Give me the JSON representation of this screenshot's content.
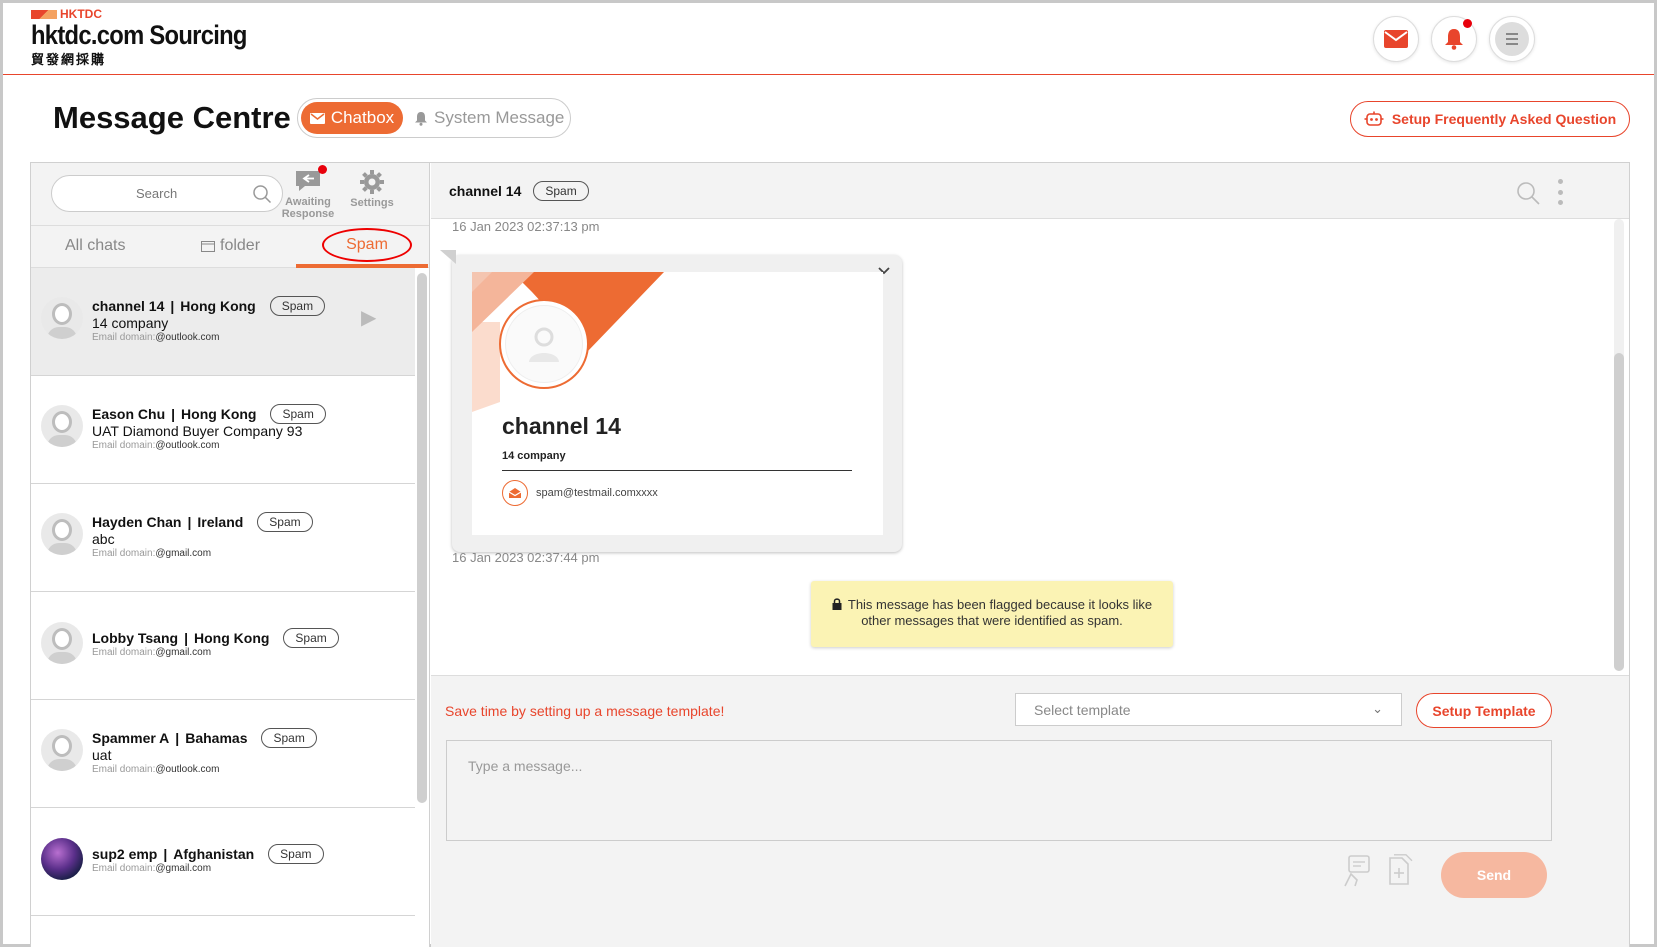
{
  "brand": {
    "org": "HKTDC",
    "name": "hktdc.com Sourcing",
    "sub": "貿發網採購",
    "accent": "#ed6b33"
  },
  "header": {
    "title": "Message Centre",
    "toggle": {
      "active": "Chatbox",
      "inactive": "System Message"
    },
    "faq_button": "Setup Frequently Asked Question"
  },
  "sidebar": {
    "search_placeholder": "Search",
    "awaiting_label": "Awaiting Response",
    "settings_label": "Settings",
    "tabs": [
      "All chats",
      "folder",
      "Spam"
    ],
    "email_prefix": "Email domain:",
    "chats": [
      {
        "name": "channel 14",
        "country": "Hong Kong",
        "badge": "Spam",
        "company": "14 company",
        "domain": "@outlook.com"
      },
      {
        "name": "Eason Chu",
        "country": "Hong Kong",
        "badge": "Spam",
        "company": "UAT Diamond Buyer Company 93",
        "domain": "@outlook.com"
      },
      {
        "name": "Hayden Chan",
        "country": "Ireland",
        "badge": "Spam",
        "company": "abc",
        "domain": "@gmail.com"
      },
      {
        "name": "Lobby Tsang",
        "country": "Hong Kong",
        "badge": "Spam",
        "company": "",
        "domain": "@gmail.com"
      },
      {
        "name": "Spammer A",
        "country": "Bahamas",
        "badge": "Spam",
        "company": "uat",
        "domain": "@outlook.com"
      },
      {
        "name": "sup2 emp",
        "country": "Afghanistan",
        "badge": "Spam",
        "company": "",
        "domain": "@gmail.com"
      }
    ]
  },
  "chat": {
    "title": "channel 14",
    "badge": "Spam",
    "timestamp1": "16 Jan 2023 02:37:13 pm",
    "card": {
      "name": "channel 14",
      "company": "14 company",
      "email": "spam@testmail.comxxxx"
    },
    "timestamp2": "16 Jan 2023 02:37:44 pm",
    "flag_note": "This message has been flagged because it looks like other messages that were identified as spam."
  },
  "composer": {
    "template_hint": "Save time by setting up a message template!",
    "template_placeholder": "Select template",
    "template_button": "Setup Template",
    "message_placeholder": "Type a message...",
    "send_button": "Send"
  }
}
